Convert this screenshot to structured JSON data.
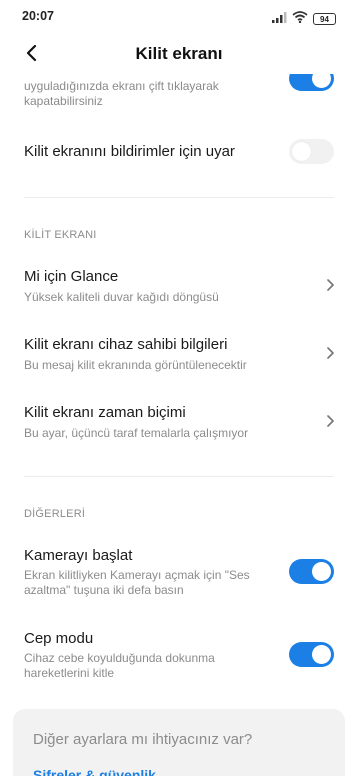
{
  "status": {
    "time": "20:07",
    "battery": "94"
  },
  "header": {
    "title": "Kilit ekranı"
  },
  "partial": {
    "text": "uyguladığınızda ekranı çift tıklayarak kapatabilirsiniz",
    "toggle_on": true
  },
  "rows": [
    {
      "title": "Kilit ekranını bildirimler için uyar",
      "toggle_on": false
    }
  ],
  "sections": [
    {
      "label": "KİLİT EKRANI",
      "items": [
        {
          "title": "Mi için Glance",
          "subtitle": "Yüksek kaliteli duvar kağıdı döngüsü"
        },
        {
          "title": "Kilit ekranı cihaz sahibi bilgileri",
          "subtitle": "Bu mesaj kilit ekranında görüntülenecektir"
        },
        {
          "title": "Kilit ekranı zaman biçimi",
          "subtitle": "Bu ayar, üçüncü taraf temalarla çalışmıyor"
        }
      ]
    },
    {
      "label": "DİĞERLERİ",
      "items": [
        {
          "title": "Kamerayı başlat",
          "subtitle": "Ekran kilitliyken Kamerayı açmak için \"Ses azaltma\" tuşuna iki defa basın",
          "toggle_on": true
        },
        {
          "title": "Cep modu",
          "subtitle": "Cihaz cebe koyulduğunda dokunma hareketlerini kitle",
          "toggle_on": true
        }
      ]
    }
  ],
  "card": {
    "title": "Diğer ayarlara mı ihtiyacınız var?",
    "link": "Şifreler & güvenlik"
  },
  "colors": {
    "accent": "#1b7fe5",
    "toggle_off": "#f1f1f1"
  }
}
